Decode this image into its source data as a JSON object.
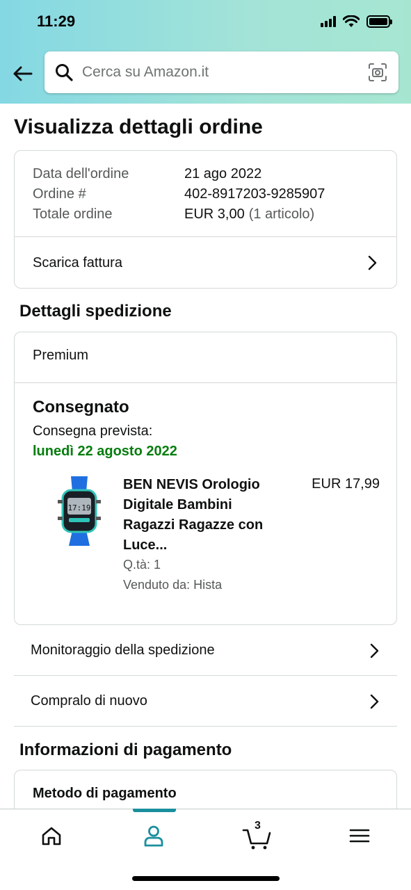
{
  "status_bar": {
    "time": "11:29"
  },
  "header": {
    "search": {
      "placeholder": "Cerca su Amazon.it"
    }
  },
  "page_title": "Visualizza dettagli ordine",
  "order_summary": {
    "rows": [
      {
        "label": "Data dell'ordine",
        "value": "21 ago 2022",
        "extra": ""
      },
      {
        "label": "Ordine #",
        "value": "402-8917203-9285907",
        "extra": ""
      },
      {
        "label": "Totale ordine",
        "value": "EUR 3,00",
        "extra": "(1 articolo)"
      }
    ],
    "invoice_link": "Scarica fattura"
  },
  "shipment": {
    "section_title": "Dettagli spedizione",
    "shipping_type": "Premium",
    "status": "Consegnato",
    "expected_label": "Consegna prevista:",
    "expected_date": "lunedì 22 agosto 2022",
    "product": {
      "title": "BEN NEVIS Orologio Digitale Bambini Ragazzi Ragazze con Luce...",
      "price": "EUR 17,99",
      "quantity": "Q.tà: 1",
      "seller": "Venduto da: Hista"
    }
  },
  "actions": [
    {
      "label": "Monitoraggio della spedizione"
    },
    {
      "label": "Compralo di nuovo"
    }
  ],
  "payment": {
    "section_title": "Informazioni di pagamento",
    "method_label": "Metodo di pagamento"
  },
  "tabbar": {
    "cart_count": "3",
    "active_tab": "account"
  },
  "colors": {
    "accent": "#1a8f9e",
    "delivery_green": "#067d0e",
    "header_gradient_start": "#84d8e3",
    "header_gradient_end": "#a6e6d1"
  }
}
